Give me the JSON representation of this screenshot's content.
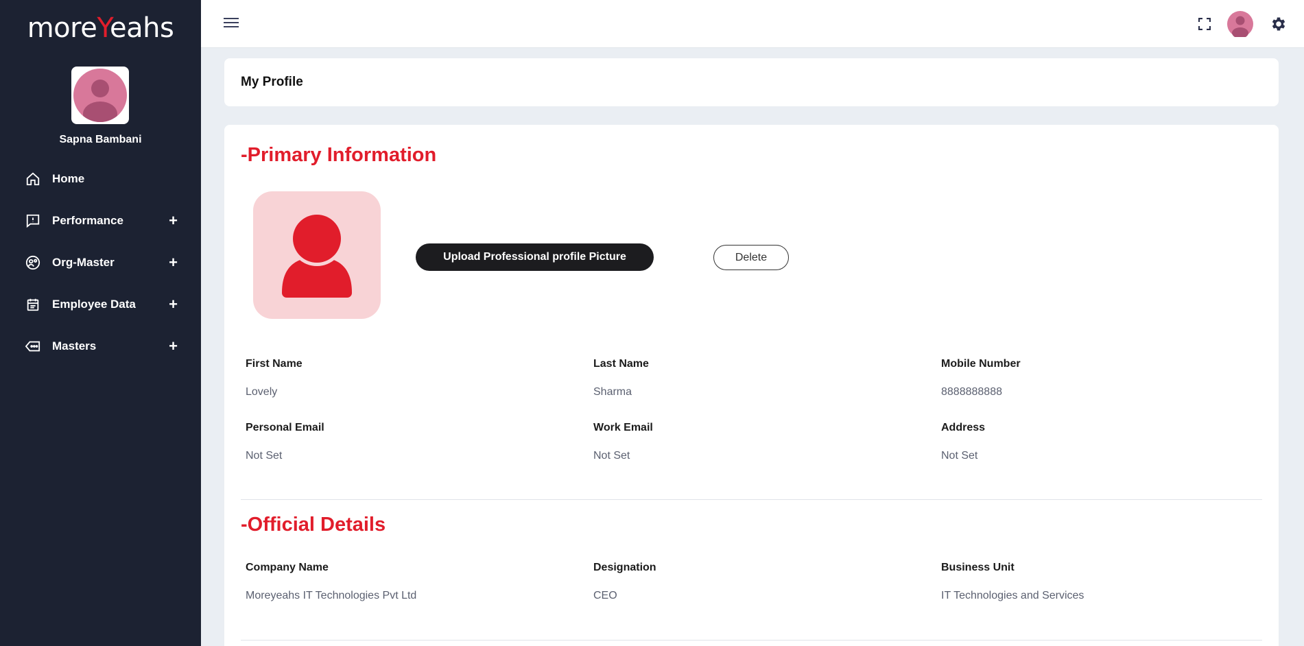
{
  "brand": {
    "logo_pre": "more",
    "logo_mid": "Y",
    "logo_post": "eahs"
  },
  "sidebar": {
    "user_name": "Sapna Bambani",
    "items": [
      {
        "label": "Home",
        "icon": "home-icon",
        "expandable": false
      },
      {
        "label": "Performance",
        "icon": "feedback-icon",
        "expandable": true
      },
      {
        "label": "Org-Master",
        "icon": "org-icon",
        "expandable": true
      },
      {
        "label": "Employee Data",
        "icon": "calendar-icon",
        "expandable": true
      },
      {
        "label": "Masters",
        "icon": "tag-icon",
        "expandable": true
      }
    ],
    "expand_symbol": "+"
  },
  "topbar": {
    "icons": [
      "menu-icon",
      "fullscreen-icon",
      "avatar",
      "gear-icon"
    ]
  },
  "page": {
    "title": "My Profile"
  },
  "primary": {
    "title": "-Primary Information",
    "upload_label": "Upload Professional profile Picture",
    "delete_label": "Delete",
    "fields": [
      {
        "label": "First Name",
        "value": "Lovely"
      },
      {
        "label": "Last Name",
        "value": "Sharma"
      },
      {
        "label": "Mobile Number",
        "value": "8888888888"
      },
      {
        "label": "Personal Email",
        "value": "Not Set"
      },
      {
        "label": "Work Email",
        "value": "Not Set"
      },
      {
        "label": "Address",
        "value": "Not Set"
      }
    ]
  },
  "official": {
    "title": "-Official Details",
    "fields": [
      {
        "label": "Company Name",
        "value": "Moreyeahs IT Technologies Pvt Ltd"
      },
      {
        "label": "Designation",
        "value": "CEO"
      },
      {
        "label": "Business Unit",
        "value": "IT Technologies and Services"
      }
    ]
  },
  "colors": {
    "accent": "#e11d2b",
    "sidebar_bg": "#1c2232",
    "avatar_pink": "#d8789a"
  }
}
